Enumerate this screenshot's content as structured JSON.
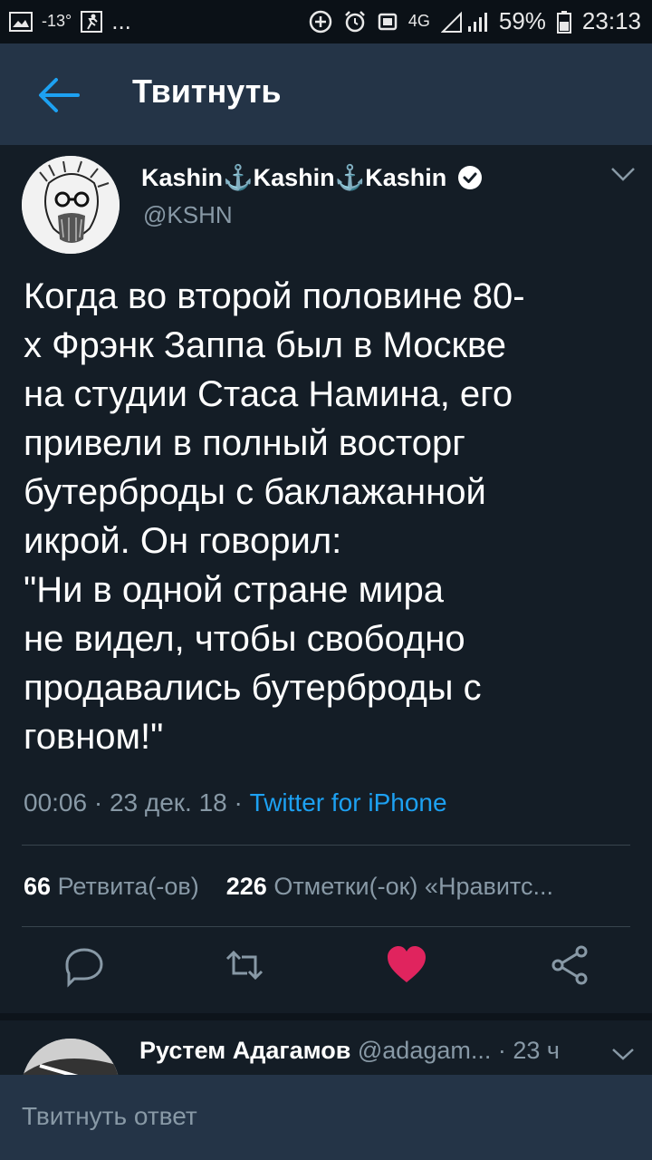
{
  "status_bar": {
    "temperature": "-13°",
    "dots": "...",
    "network": "4G",
    "battery": "59%",
    "time": "23:13"
  },
  "app_bar": {
    "title": "Твитнуть"
  },
  "tweet": {
    "author_name": "Kashin⚓Kashin⚓Kashin",
    "handle": "@KSHN",
    "text": "Когда во второй половине 80-\nх Фрэнк Заппа был в Москве\nна студии Стаса Намина, его\nпривели в полный восторг\nбутерброды с баклажанной\nикрой. Он говорил:\n\"Ни в одной стране мира\nне видел, чтобы свободно\nпродавались бутерброды с\nговном!\"",
    "time": "00:06",
    "date": "23 дек. 18",
    "source": "Twitter for iPhone",
    "retweets_count": "66",
    "retweets_label": "Ретвита(-ов)",
    "likes_count": "226",
    "likes_label": "Отметки(-ок) «Нравитс..."
  },
  "reply": {
    "name": "Рустем Адагамов",
    "handle": "@adagam...",
    "time": "· 23 ч"
  },
  "composer": {
    "placeholder": "Твитнуть ответ"
  },
  "colors": {
    "background": "#141d26",
    "app_bar": "#243447",
    "accent": "#1da1f2",
    "like": "#e0245e",
    "muted": "#8899a6"
  },
  "icons": [
    "back-arrow-icon",
    "verified-icon",
    "chevron-down-icon",
    "reply-icon",
    "retweet-icon",
    "like-icon",
    "share-icon"
  ]
}
